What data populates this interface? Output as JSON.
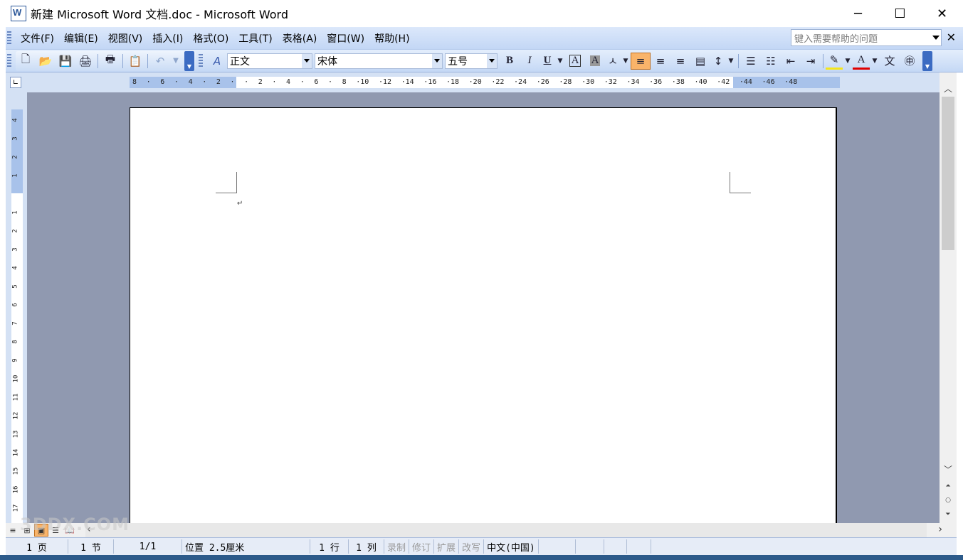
{
  "window": {
    "title": "新建 Microsoft Word 文档.doc - Microsoft Word",
    "minimize": "─",
    "maximize": "☐",
    "close": "✕"
  },
  "menu": {
    "items": [
      "文件(F)",
      "编辑(E)",
      "视图(V)",
      "插入(I)",
      "格式(O)",
      "工具(T)",
      "表格(A)",
      "窗口(W)",
      "帮助(H)"
    ],
    "help_placeholder": "键入需要帮助的问题",
    "close_doc": "✕"
  },
  "toolbar": {
    "style": "正文",
    "font": "宋体",
    "size": "五号",
    "bold": "B",
    "italic": "I",
    "underline": "U"
  },
  "ruler": {
    "ticks": "8 · 6 · 4 · 2 ·   · 2 · 4 · 6 · 8 ·10 ·12 ·14 ·16 ·18 ·20 ·22 ·24 ·26 ·28 ·30 ·32 ·34 ·36 ·38 ·40 ·42 ·44 ·46 ·48",
    "vertical_top": [
      "4",
      "3",
      "2",
      "1"
    ],
    "vertical": [
      "1",
      "2",
      "3",
      "4",
      "5",
      "6",
      "7",
      "8",
      "9",
      "10",
      "11",
      "12",
      "13",
      "14",
      "15",
      "16",
      "17"
    ]
  },
  "document": {
    "paragraph_mark": "↵"
  },
  "statusbar": {
    "page": "1 页",
    "section": "1 节",
    "page_of": "1/1",
    "position": "位置 2.5厘米",
    "line": "1 行",
    "column": "1 列",
    "record": "录制",
    "track": "修订",
    "extend": "扩展",
    "overwrite": "改写",
    "language": "中文(中国)"
  },
  "watermark": "3DDX.COM",
  "colors": {
    "menubar": "#c3d7f5",
    "workspace": "#9099b0",
    "active_button": "#f9b46a"
  }
}
